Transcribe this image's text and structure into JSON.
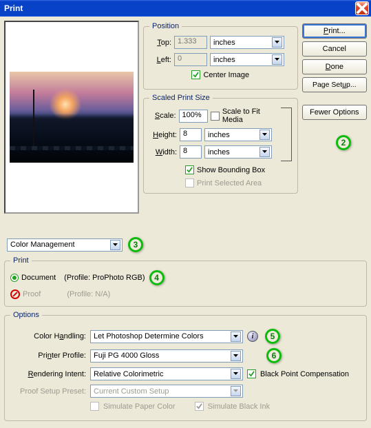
{
  "window": {
    "title": "Print"
  },
  "buttons": {
    "print": "Print...",
    "cancel": "Cancel",
    "done": "Done",
    "page_setup": "Page Setup...",
    "fewer_options": "Fewer Options"
  },
  "position": {
    "legend": "Position",
    "top_label": "Top:",
    "top_value": "1.333",
    "top_units": "inches",
    "left_label": "Left:",
    "left_value": "0",
    "left_units": "inches",
    "center_label": "Center Image",
    "center_checked": true
  },
  "scaled": {
    "legend": "Scaled Print Size",
    "scale_label": "Scale:",
    "scale_value": "100%",
    "fit_label": "Scale to Fit Media",
    "fit_checked": false,
    "height_label": "Height:",
    "height_value": "8",
    "height_units": "inches",
    "width_label": "Width:",
    "width_value": "8",
    "width_units": "inches",
    "show_bb_label": "Show Bounding Box",
    "show_bb_checked": true,
    "print_sel_label": "Print Selected Area",
    "print_sel_checked": false
  },
  "mode_dropdown": "Color Management",
  "print_group": {
    "legend": "Print",
    "document_label": "Document",
    "document_profile": "(Profile: ProPhoto RGB)",
    "proof_label": "Proof",
    "proof_profile": "(Profile: N/A)"
  },
  "options": {
    "legend": "Options",
    "color_handling_label": "Color Handling:",
    "color_handling_value": "Let Photoshop Determine Colors",
    "printer_profile_label": "Printer Profile:",
    "printer_profile_value": "Fuji PG 4000 Gloss",
    "rendering_intent_label": "Rendering Intent:",
    "rendering_intent_value": "Relative Colorimetric",
    "bpc_label": "Black Point Compensation",
    "bpc_checked": true,
    "proof_preset_label": "Proof Setup Preset:",
    "proof_preset_value": "Current Custom Setup",
    "sim_paper_label": "Simulate Paper Color",
    "sim_paper_checked": false,
    "sim_black_label": "Simulate Black Ink",
    "sim_black_checked": true
  },
  "annotations": {
    "a2": "2",
    "a3": "3",
    "a4": "4",
    "a5": "5",
    "a6": "6"
  }
}
